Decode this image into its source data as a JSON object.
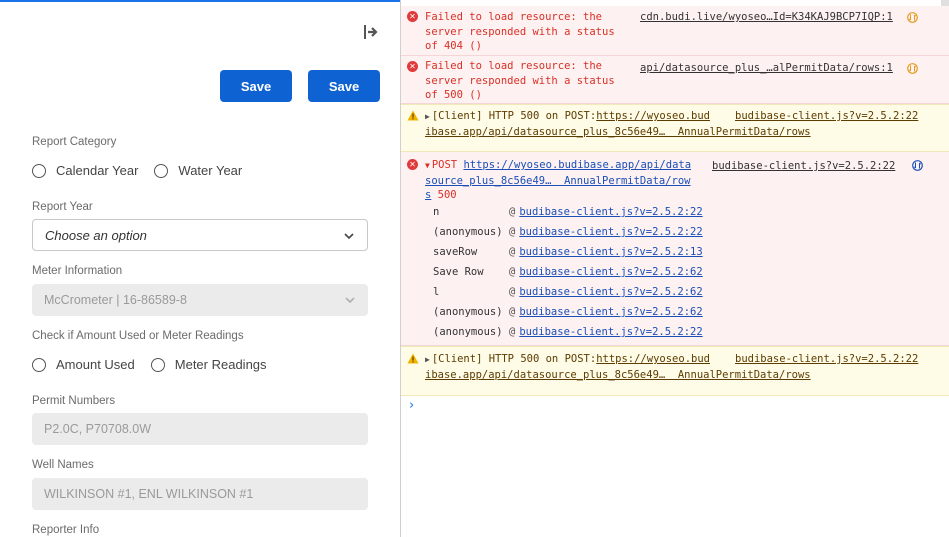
{
  "form": {
    "save_buttons": [
      "Save",
      "Save"
    ],
    "report_category": {
      "label": "Report Category",
      "options": [
        "Calendar Year",
        "Water Year"
      ]
    },
    "report_year": {
      "label": "Report Year",
      "placeholder": "Choose an option"
    },
    "meter_information": {
      "label": "Meter Information",
      "value": "McCrometer | 16-86589-8"
    },
    "amount_or_readings": {
      "label": "Check if Amount Used or Meter Readings",
      "options": [
        "Amount Used",
        "Meter Readings"
      ]
    },
    "permit_numbers": {
      "label": "Permit Numbers",
      "value": "P2.0C, P70708.0W"
    },
    "well_names": {
      "label": "Well Names",
      "value": "WILKINSON #1, ENL WILKINSON #1"
    },
    "reporter_info": {
      "label": "Reporter Info"
    }
  },
  "console": {
    "entries": [
      {
        "level": "error",
        "lines": [
          "Failed to load resource: the",
          "server responded with a status",
          "of 404 ()"
        ],
        "source": "cdn.budi.live/wyoseo…Id=K34KAJ9BCP7IQP:1"
      },
      {
        "level": "error",
        "lines": [
          "Failed to load resource: the",
          "server responded with a status",
          "of 500 ()"
        ],
        "source": "api/datasource_plus_…alPermitData/rows:1"
      },
      {
        "level": "warning",
        "prefix": "[Client] HTTP 500 on POST:",
        "url_part1": "https://wyoseo.bud",
        "url_part2": "ibase.app/api/datasource_plus_8c56e49…  AnnualPermitData/rows",
        "source": "budibase-client.js?v=2.5.2:22"
      },
      {
        "level": "error",
        "method": "POST",
        "url_lines": [
          "https://wyoseo.budibase.app/api/data",
          "source_plus_8c56e49…  AnnualPermitData/row",
          "s"
        ],
        "status": "500",
        "source": "budibase-client.js?v=2.5.2:22",
        "stack": [
          {
            "fn": "n",
            "at": "@",
            "src": "budibase-client.js?v=2.5.2:22"
          },
          {
            "fn": "(anonymous)",
            "at": "@",
            "src": "budibase-client.js?v=2.5.2:22"
          },
          {
            "fn": "saveRow",
            "at": "@",
            "src": "budibase-client.js?v=2.5.2:13"
          },
          {
            "fn": "Save Row",
            "at": "@",
            "src": "budibase-client.js?v=2.5.2:62"
          },
          {
            "fn": "l",
            "at": "@",
            "src": "budibase-client.js?v=2.5.2:62"
          },
          {
            "fn": "(anonymous)",
            "at": "@",
            "src": "budibase-client.js?v=2.5.2:62"
          },
          {
            "fn": "(anonymous)",
            "at": "@",
            "src": "budibase-client.js?v=2.5.2:22"
          }
        ]
      },
      {
        "level": "warning",
        "prefix": "[Client] HTTP 500 on POST:",
        "url_part1": "https://wyoseo.bud",
        "url_part2": "ibase.app/api/datasource_plus_8c56e49…  AnnualPermitData/rows",
        "source": "budibase-client.js?v=2.5.2:22"
      }
    ],
    "prompt": "›"
  },
  "colors": {
    "primary_button": "#0f62d1",
    "error_text": "#d93025",
    "error_bg": "#fdf1f1",
    "warning_bg": "#fefbe7",
    "link": "#1a4fb8"
  }
}
